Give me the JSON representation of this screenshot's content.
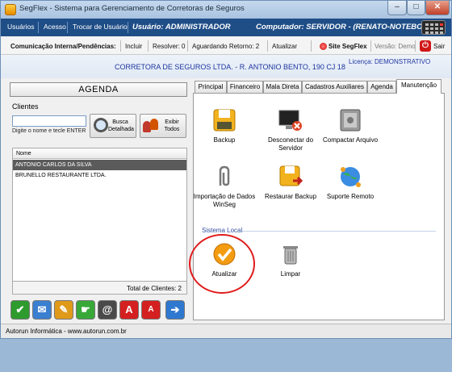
{
  "window": {
    "title": "SegFlex - Sistema para Gerenciamento de Corretoras de Seguros"
  },
  "menu": {
    "items": [
      "Usuários",
      "Acesso",
      "Trocar de Usuário"
    ],
    "user": "Usuário: ADMINISTRADOR",
    "computer": "Computador: SERVIDOR - (RENATO-NOTEBOOK)"
  },
  "toolbar": {
    "comm_label": "Comunicação Interna/Pendências:",
    "include": "Incluir",
    "resolve": "Resolver: 0",
    "awaiting": "Aguardando Retorno: 2",
    "update": "Atualizar",
    "site": "Site SegFlex",
    "version": "Versão: Demo",
    "exit": "Sair"
  },
  "header": {
    "company": "CORRETORA DE SEGUROS LTDA. - R. ANTONIO BENTO, 190 CJ 18",
    "license": "Licença: DEMONSTRATIVO"
  },
  "left": {
    "agenda": "AGENDA",
    "clients_label": "Clientes",
    "search_value": "",
    "search_hint": "Digite o nome e tecle ENTER",
    "search_button": "Busca Detalhada",
    "show_all_button": "Exibir Todos",
    "list_header": "Nome",
    "clients": [
      "ANTONIO CARLOS DA SILVA",
      "BRUNELLO RESTAURANTE LTDA."
    ],
    "total": "Total de Clientes: 2"
  },
  "tabs": [
    "Principal",
    "Financeiro",
    "Mala Direta",
    "Cadastros Auxiliares",
    "Agenda",
    "Manutenção"
  ],
  "active_tab": "Manutenção",
  "maintenance": {
    "tiles": [
      {
        "label": "Backup",
        "icon": "floppy-disk-icon"
      },
      {
        "label": "Desconectar do Servidor",
        "icon": "disconnect-monitor-icon"
      },
      {
        "label": "Compactar Arquivo",
        "icon": "safe-icon"
      },
      {
        "label": "Importação de Dados WinSeg",
        "icon": "paperclip-icon"
      },
      {
        "label": "Restaurar Backup",
        "icon": "restore-floppy-icon"
      },
      {
        "label": "Suporte Remoto",
        "icon": "globe-network-icon"
      }
    ],
    "local_section": "Sistema Local",
    "local_tiles": [
      {
        "label": "Atualizar",
        "icon": "checkmark-circle-icon"
      },
      {
        "label": "Limpar",
        "icon": "trash-can-icon"
      }
    ]
  },
  "bottom_buttons": [
    {
      "name": "confirm-button",
      "icon": "check-icon",
      "glyph": "✔",
      "color": "#2e9b2e"
    },
    {
      "name": "email-button",
      "icon": "envelope-icon",
      "glyph": "✉",
      "color": "#3a7fd0"
    },
    {
      "name": "edit-button",
      "icon": "pencil-icon",
      "glyph": "✎",
      "color": "#e09a1a"
    },
    {
      "name": "hand-button",
      "icon": "hand-icon",
      "glyph": "☛",
      "color": "#38a838"
    },
    {
      "name": "at-button",
      "icon": "at-sign-icon",
      "glyph": "@",
      "color": "#4a4a4a"
    },
    {
      "name": "font-large-button",
      "icon": "font-a-icon",
      "glyph": "A",
      "color": "#d42020"
    },
    {
      "name": "font-small-button",
      "icon": "font-a-small-icon",
      "glyph": "A",
      "color": "#d42020"
    },
    {
      "name": "next-button",
      "icon": "arrow-right-icon",
      "glyph": "➔",
      "color": "#2f78cf"
    }
  ],
  "status": "Autorun Informática - www.autorun.com.br"
}
